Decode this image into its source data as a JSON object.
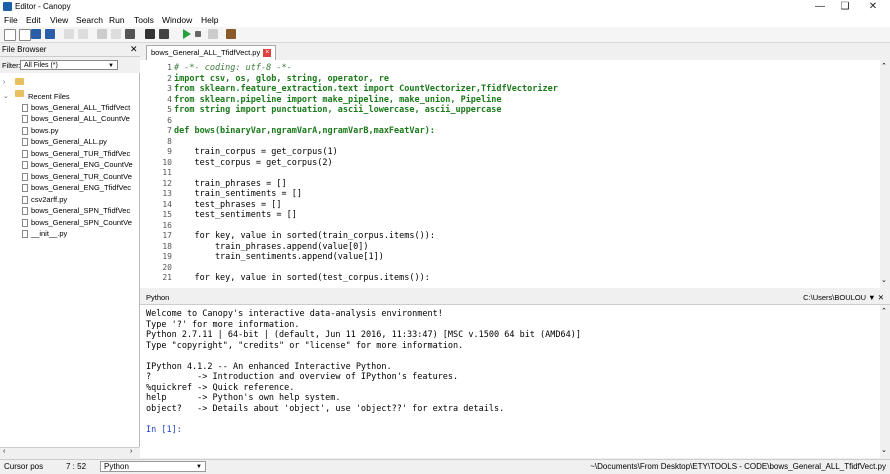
{
  "window": {
    "title": "Editor - Canopy"
  },
  "menu": [
    "File",
    "Edit",
    "View",
    "Search",
    "Run",
    "Tools",
    "Window",
    "Help"
  ],
  "file_browser": {
    "title": "File Browser",
    "filter_label": "Filter:",
    "filter_value": "All Files (*)",
    "recent_label": "Recent Files",
    "files": [
      "bows_General_ALL_TfidfVect",
      "bows_General_ALL_CountVe",
      "bows.py",
      "bows_General_ALL.py",
      "bows_General_TUR_TfidfVec",
      "bows_General_ENG_CountVe",
      "bows_General_TUR_CountVe",
      "bows_General_ENG_TfidfVec",
      "csv2arff.py",
      "bows_General_SPN_TfidfVec",
      "bows_General_SPN_CountVe",
      "__init__.py"
    ]
  },
  "editor": {
    "tab_label": "bows_General_ALL_TfidfVect.py",
    "lines": [
      {
        "n": "1",
        "t": "# -*- coding: utf-8 -*-"
      },
      {
        "n": "2",
        "t": "import csv, os, glob, string, operator, re"
      },
      {
        "n": "3",
        "t": "from sklearn.feature_extraction.text import CountVectorizer,TfidfVectorizer"
      },
      {
        "n": "4",
        "t": "from sklearn.pipeline import make_pipeline, make_union, Pipeline"
      },
      {
        "n": "5",
        "t": "from string import punctuation, ascii_lowercase, ascii_uppercase"
      },
      {
        "n": "6",
        "t": ""
      },
      {
        "n": "7",
        "t": "def bows(binaryVar,ngramVarA,ngramVarB,maxFeatVar):"
      },
      {
        "n": "8",
        "t": ""
      },
      {
        "n": "9",
        "t": "    train_corpus = get_corpus(1)"
      },
      {
        "n": "10",
        "t": "    test_corpus = get_corpus(2)"
      },
      {
        "n": "11",
        "t": ""
      },
      {
        "n": "12",
        "t": "    train_phrases = []"
      },
      {
        "n": "13",
        "t": "    train_sentiments = []"
      },
      {
        "n": "14",
        "t": "    test_phrases = []"
      },
      {
        "n": "15",
        "t": "    test_sentiments = []"
      },
      {
        "n": "16",
        "t": ""
      },
      {
        "n": "17",
        "t": "    for key, value in sorted(train_corpus.items()):"
      },
      {
        "n": "18",
        "t": "        train_phrases.append(value[0])"
      },
      {
        "n": "19",
        "t": "        train_sentiments.append(value[1])"
      },
      {
        "n": "20",
        "t": ""
      },
      {
        "n": "21",
        "t": "    for key, value in sorted(test_corpus.items()):"
      }
    ]
  },
  "python_pane": {
    "title": "Python",
    "path": "C:\\Users\\BOULOU",
    "lines": [
      "Welcome to Canopy's interactive data-analysis environment!",
      "Type '?' for more information.",
      "Python 2.7.11 | 64-bit | (default, Jun 11 2016, 11:33:47) [MSC v.1500 64 bit (AMD64)]",
      "Type \"copyright\", \"credits\" or \"license\" for more information.",
      "",
      "IPython 4.1.2 -- An enhanced Interactive Python.",
      "?         -> Introduction and overview of IPython's features.",
      "%quickref -> Quick reference.",
      "help      -> Python's own help system.",
      "object?   -> Details about 'object', use 'object??' for extra details.",
      "",
      "In [1]:"
    ]
  },
  "status": {
    "cursor_label": "Cursor pos",
    "cursor_value": "7 : 52",
    "language": "Python",
    "file_path": "~\\Documents\\From Desktop\\ETY\\TOOLS - CODE\\bows_General_ALL_TfidfVect.py"
  }
}
